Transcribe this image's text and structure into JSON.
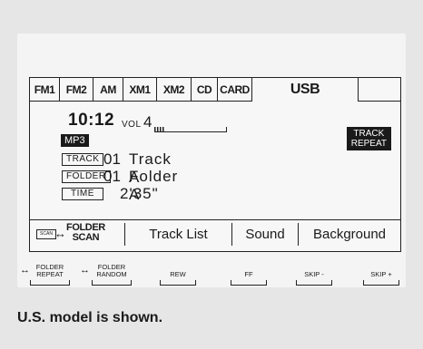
{
  "tabs": [
    "FM1",
    "FM2",
    "AM",
    "XM1",
    "XM2",
    "CD",
    "CARD",
    "USB"
  ],
  "active_tab": "USB",
  "display": {
    "time": "10:12",
    "vol_label": "VOL",
    "vol_value": "4",
    "vol_level": 0.15,
    "format": "MP3",
    "repeat_badge": [
      "TRACK",
      "REPEAT"
    ],
    "track_label": "TRACK",
    "track_num": "01",
    "track_name": "Track A",
    "folder_label": "FOLDER",
    "folder_num": "01",
    "folder_name": "Folder A",
    "time_label": "TIME",
    "time_value": "2'35\""
  },
  "menu": {
    "scan_icon_text": "SCAN",
    "folder_scan": [
      "FOLDER",
      "SCAN"
    ],
    "buttons": [
      "Track List",
      "Sound",
      "Background"
    ]
  },
  "bottom_buttons": [
    {
      "line1": "FOLDER",
      "line2": "REPEAT"
    },
    {
      "line1": "FOLDER",
      "line2": "RANDOM"
    },
    {
      "line1": "REW",
      "line2": ""
    },
    {
      "line1": "FF",
      "line2": ""
    },
    {
      "line1": "SKIP -",
      "line2": ""
    },
    {
      "line1": "SKIP +",
      "line2": ""
    }
  ],
  "caption": "U.S. model is shown."
}
